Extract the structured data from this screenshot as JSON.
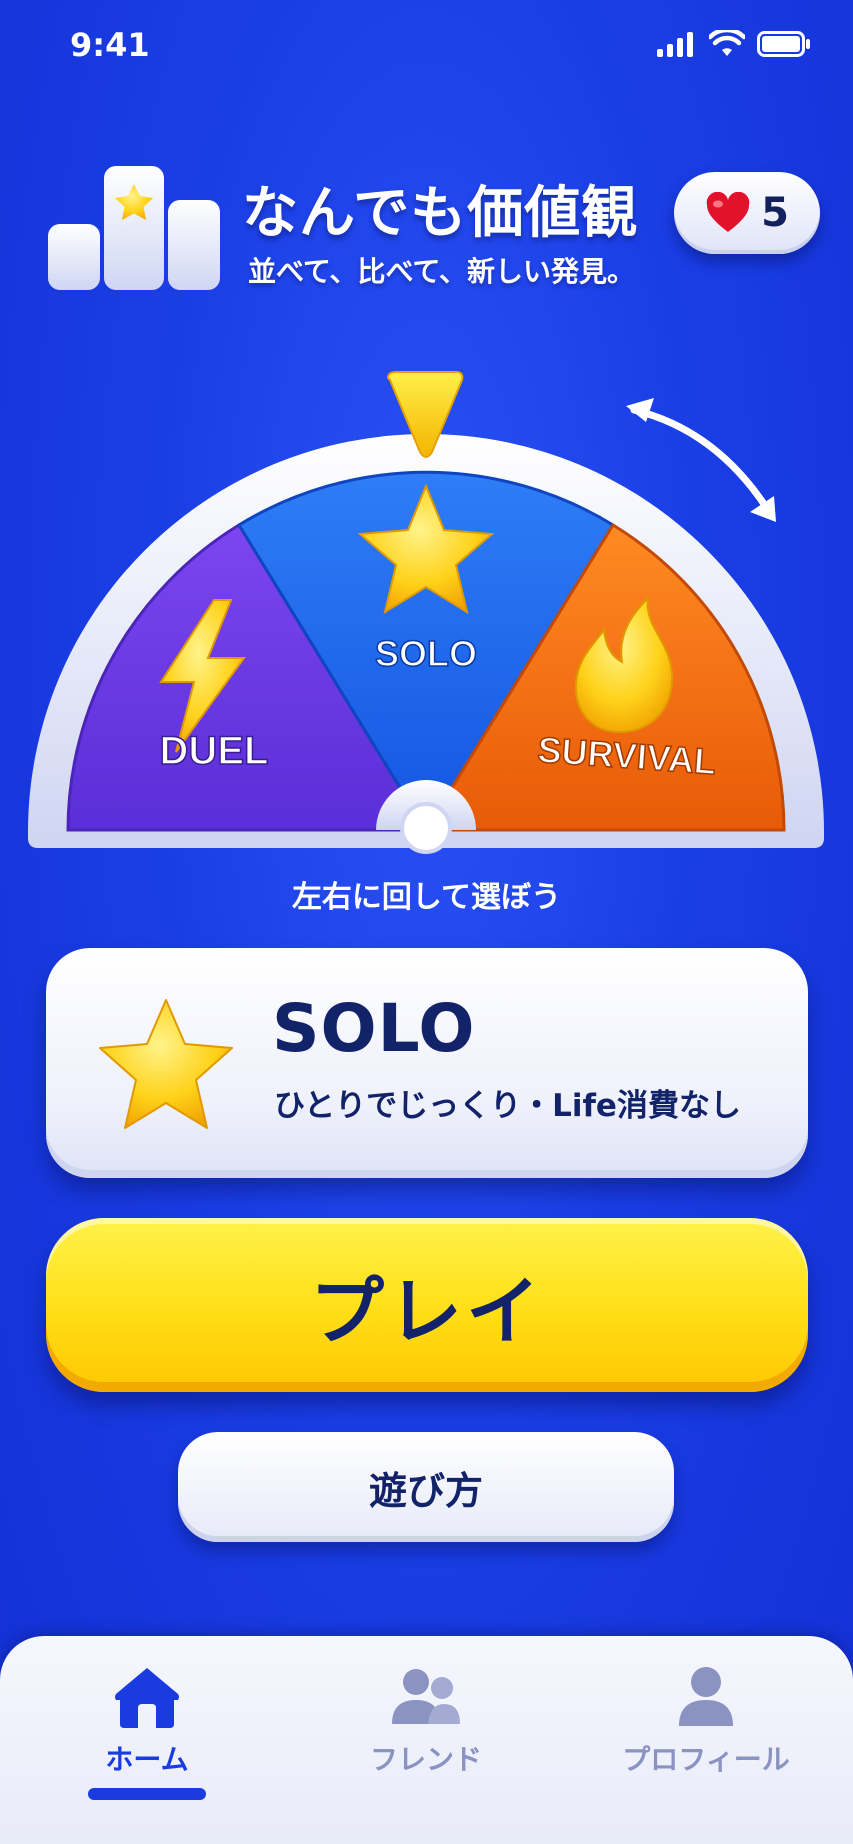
{
  "status_bar": {
    "time": "9:41",
    "icons": [
      "signal-icon",
      "wifi-icon",
      "battery-icon"
    ]
  },
  "header": {
    "logo_icon": "podium-star-icon",
    "title": "なんでも価値観",
    "subtitle": "並べて、比べて、新しい発見。",
    "lives": {
      "icon": "heart-icon",
      "count": "5"
    }
  },
  "mode_wheel": {
    "segments": [
      {
        "id": "duel",
        "label": "DUEL",
        "icon": "lightning-icon",
        "color": "#6a3be8"
      },
      {
        "id": "solo",
        "label": "SOLO",
        "icon": "star-icon",
        "color": "#1b63f0"
      },
      {
        "id": "survival",
        "label": "SURVIVAL",
        "icon": "flame-icon",
        "color": "#f26a12"
      }
    ],
    "selected": "SOLO",
    "pointer_icon": "triangle-pointer-icon",
    "rotate_icon": "rotate-arrow-icon",
    "hint": "左右に回して選ぼう"
  },
  "mode_card": {
    "icon": "star-icon",
    "title": "SOLO",
    "description": "ひとりでじっくり・Life消費なし"
  },
  "play_button": {
    "label": "プレイ"
  },
  "howto_button": {
    "label": "遊び方"
  },
  "tab_bar": {
    "tabs": [
      {
        "label": "ホーム",
        "icon": "home-icon",
        "active": true
      },
      {
        "label": "フレンド",
        "icon": "friends-icon",
        "active": false
      },
      {
        "label": "プロフィール",
        "icon": "profile-icon",
        "active": false
      }
    ]
  },
  "colors": {
    "background": "#1a3ee6",
    "accent_yellow": "#ffd60a",
    "text_dark": "#12236a",
    "tab_active": "#1a3be0",
    "tab_inactive": "#8a93c2"
  }
}
